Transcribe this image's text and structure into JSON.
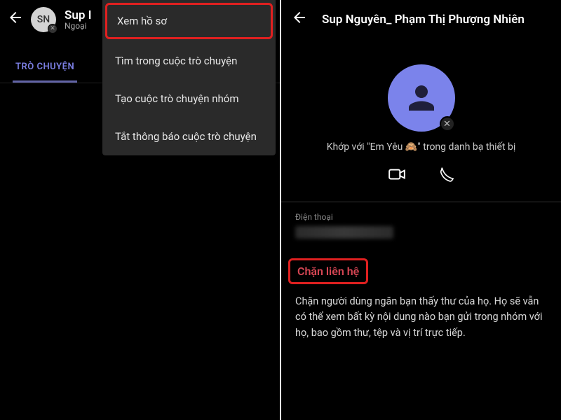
{
  "left": {
    "avatar_initials": "SN",
    "title": "Sup I",
    "subtitle": "Ngoại",
    "tab_label": "TRÒ CHUYỆN",
    "menu": {
      "view_profile": "Xem hồ sơ",
      "search_in_chat": "Tìm trong cuộc trò chuyện",
      "create_group": "Tạo cuộc trò chuyện nhóm",
      "mute": "Tắt thông báo cuộc trò chuyện"
    }
  },
  "right": {
    "title": "Sup Nguyên_ Phạm Thị Phượng Nhiên",
    "match_text": "Khớp với \"Em Yêu 🙈\" trong danh bạ thiết bị",
    "phone_label": "Điện thoại",
    "block_label": "Chặn liên hệ",
    "block_description": "Chặn người dùng ngăn bạn thấy thư của họ. Họ sẽ vẫn có thể xem bất kỳ nội dung nào bạn gửi trong nhóm với họ, bao gồm thư, tệp và vị trí trực tiếp."
  }
}
